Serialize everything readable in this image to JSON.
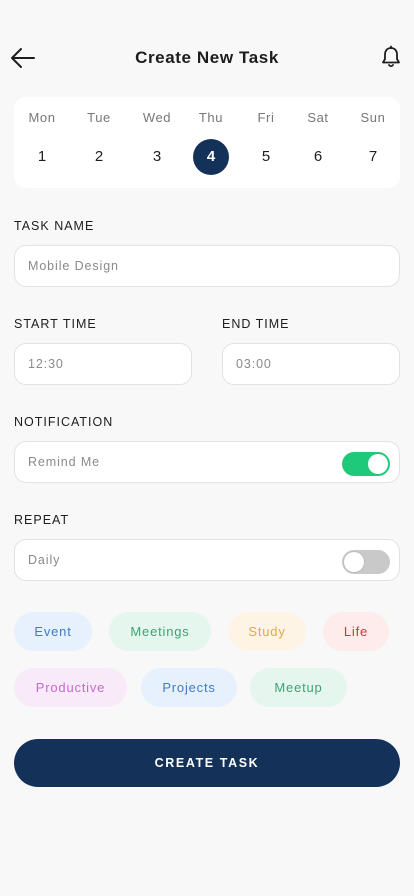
{
  "header": {
    "title": "Create New Task",
    "back_icon": "arrow-left-icon",
    "bell_icon": "bell-icon"
  },
  "calendar": {
    "days": [
      {
        "name": "Mon",
        "num": "1"
      },
      {
        "name": "Tue",
        "num": "2"
      },
      {
        "name": "Wed",
        "num": "3"
      },
      {
        "name": "Thu",
        "num": "4",
        "selected": true
      },
      {
        "name": "Fri",
        "num": "5"
      },
      {
        "name": "Sat",
        "num": "6"
      },
      {
        "name": "Sun",
        "num": "7"
      }
    ],
    "selected_color": "#14315a"
  },
  "task_name": {
    "label": "TASK NAME",
    "placeholder": "Mobile Design"
  },
  "start_time": {
    "label": "START TIME",
    "placeholder": "12:30"
  },
  "end_time": {
    "label": "END TIME",
    "placeholder": "03:00"
  },
  "notification": {
    "label": "NOTIFICATION",
    "text": "Remind Me",
    "on": true,
    "on_color": "#1ec97a"
  },
  "repeat": {
    "label": "REPEAT",
    "text": "Daily",
    "on": false
  },
  "tags": [
    {
      "label": "Event",
      "bg": "#e6f1fd",
      "fg": "#3d7cc9"
    },
    {
      "label": "Meetings",
      "bg": "#e5f6ee",
      "fg": "#3fa274"
    },
    {
      "label": "Study",
      "bg": "#fdf4e6",
      "fg": "#e1a94a"
    },
    {
      "label": "Life",
      "bg": "#fdeceb",
      "fg": "#c23b3b"
    },
    {
      "label": "Productive",
      "bg": "#f8eaf9",
      "fg": "#c46bce"
    },
    {
      "label": "Projects",
      "bg": "#e6f1fd",
      "fg": "#3d7cc9"
    },
    {
      "label": "Meetup",
      "bg": "#e5f6ee",
      "fg": "#3fa274"
    }
  ],
  "cta": {
    "label": "CREATE TASK",
    "bg": "#14315a"
  }
}
